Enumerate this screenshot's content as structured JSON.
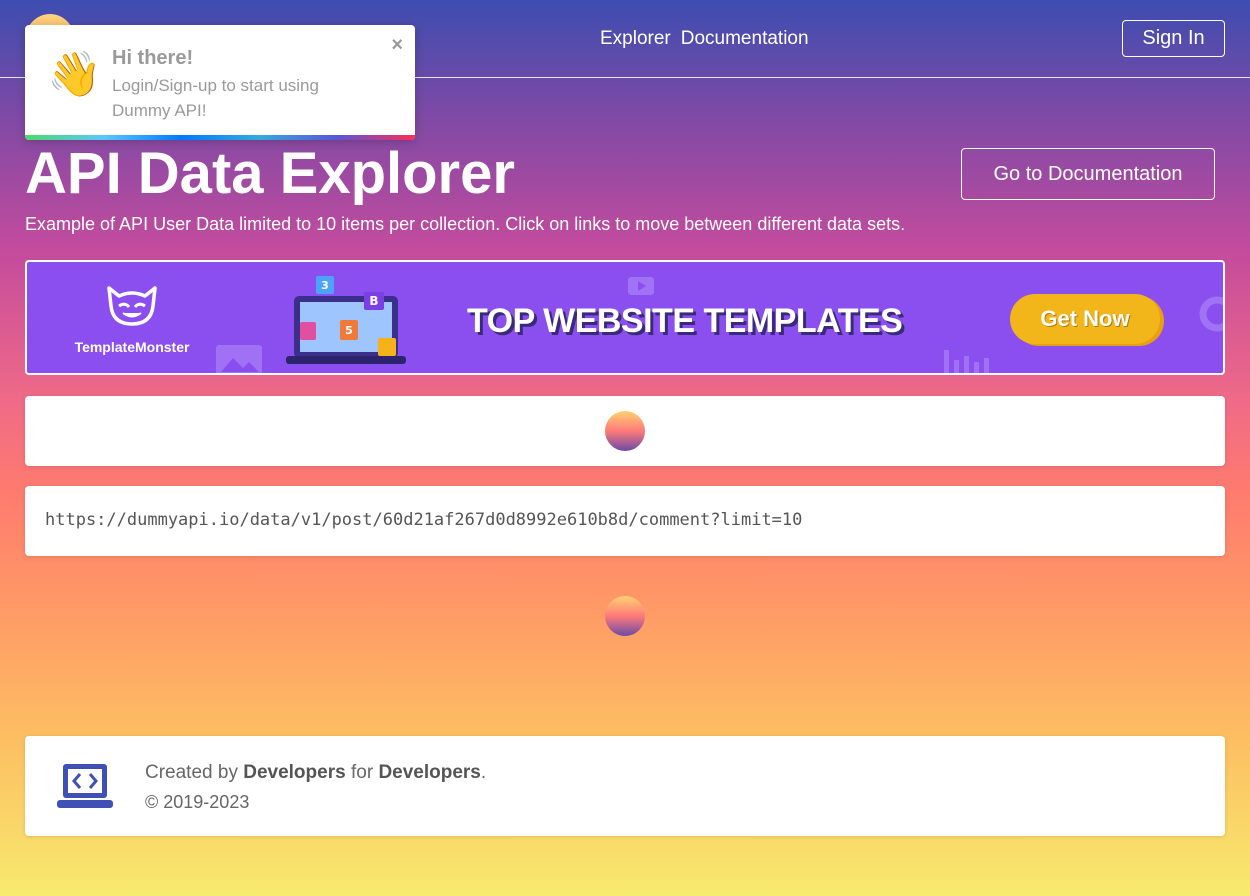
{
  "header": {
    "nav": [
      "Explorer",
      "Documentation"
    ],
    "signin_label": "Sign In"
  },
  "toast": {
    "icon": "waving-hand-icon",
    "title": "Hi there!",
    "message": "Login/Sign-up to start using Dummy API!",
    "close": "×"
  },
  "main": {
    "title": "API Data Explorer",
    "docs_button": "Go to Documentation",
    "subtitle": "Example of API User Data limited to 10 items per collection. Click on links to move between different data sets."
  },
  "banner": {
    "brand": "TemplateMonster",
    "headline": "TOP WEBSITE TEMPLATES",
    "cta": "Get Now"
  },
  "request": {
    "url": "https://dummyapi.io/data/v1/post/60d21af267d0d8992e610b8d/comment?limit=10"
  },
  "footer": {
    "created_prefix": "Created by",
    "developers_1": "Developers",
    "for_word": "for",
    "developers_2": "Developers",
    "period": ".",
    "copyright": "© 2019-2023"
  },
  "colors": {
    "banner_bg": "#8b4ff0",
    "cta": "#f3b61a",
    "footer_icon": "#3f51b5"
  }
}
